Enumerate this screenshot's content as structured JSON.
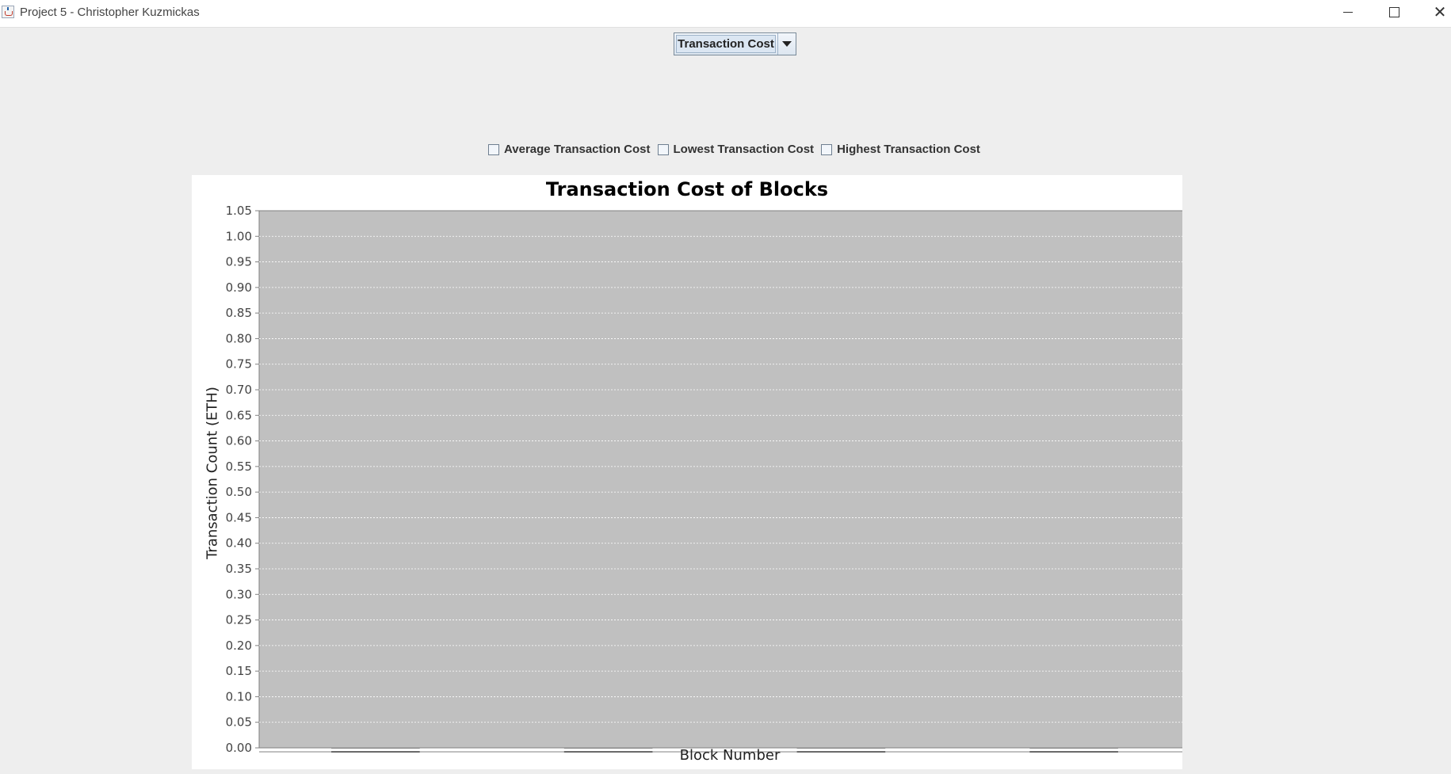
{
  "window": {
    "title": "Project 5 - Christopher Kuzmickas",
    "app_icon": "java-icon",
    "minimize_icon": "minimize-icon",
    "maximize_icon": "maximize-icon",
    "close_icon": "close-icon",
    "close_glyph": "✕"
  },
  "selector": {
    "selected": "Transaction Cost",
    "arrow_icon": "chevron-down-icon"
  },
  "checkboxes": [
    {
      "label": "Average Transaction Cost",
      "checked": false
    },
    {
      "label": "Lowest Transaction Cost",
      "checked": false
    },
    {
      "label": "Highest Transaction Cost",
      "checked": false
    }
  ],
  "colors": {
    "plot_background": "#c0c0c0",
    "gridline": "#ffffff",
    "panel_background": "#ffffff",
    "window_background": "#eeeeee"
  },
  "chart_data": {
    "type": "bar",
    "title": "Transaction Cost of Blocks",
    "xlabel": "Block Number",
    "ylabel": "Transaction Count (ETH)",
    "ylim": [
      0,
      1.05
    ],
    "y_ticks": [
      "0.00",
      "0.05",
      "0.10",
      "0.15",
      "0.20",
      "0.25",
      "0.30",
      "0.35",
      "0.40",
      "0.45",
      "0.50",
      "0.55",
      "0.60",
      "0.65",
      "0.70",
      "0.75",
      "0.80",
      "0.85",
      "0.90",
      "0.95",
      "1.00",
      "1.05"
    ],
    "categories": [
      "",
      "",
      "",
      ""
    ],
    "values": [
      0,
      0,
      0,
      0
    ],
    "grid": true,
    "legend": "none"
  }
}
